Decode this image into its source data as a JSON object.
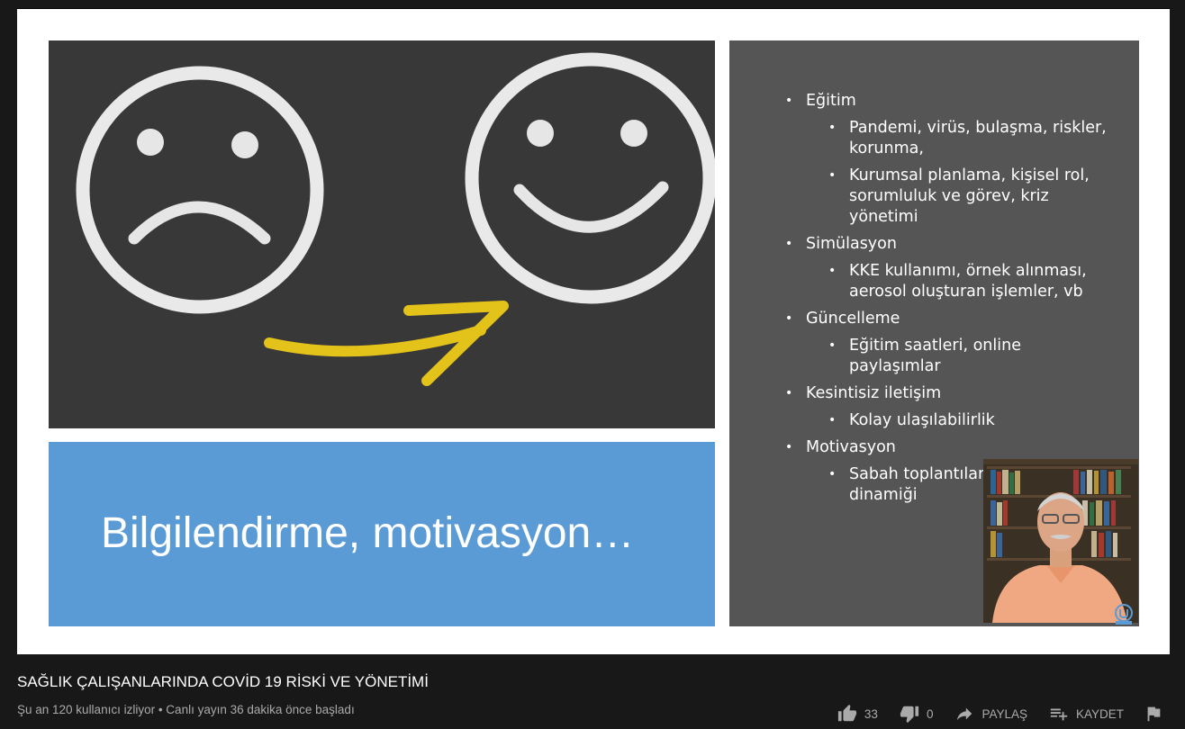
{
  "slide": {
    "caption": "Bilgilendirme, motivasyon…",
    "bullets": [
      {
        "text": "Eğitim",
        "subs": [
          "Pandemi, virüs, bulaşma, riskler, korunma,",
          "Kurumsal planlama, kişisel rol, sorumluluk ve görev, kriz yönetimi"
        ]
      },
      {
        "text": "Simülasyon",
        "subs": [
          "KKE kullanımı, örnek alınması, aerosol oluşturan işlemler, vb"
        ]
      },
      {
        "text": "Güncelleme",
        "subs": [
          "Eğitim saatleri, online paylaşımlar"
        ]
      },
      {
        "text": "Kesintisiz iletişim",
        "subs": [
          "Kolay ulaşılabilirlik"
        ]
      },
      {
        "text": "Motivasyon",
        "subs": [
          "Sabah toplantıları, dinleme, ekip dinamiği"
        ]
      }
    ]
  },
  "video": {
    "title": "SAĞLIK ÇALIŞANLARINDA COVİD 19 RİSKİ VE YÖNETİMİ",
    "meta": "Şu an 120 kullanıcı izliyor • Canlı yayın 36 dakika önce başladı",
    "likes": "33",
    "dislikes": "0",
    "share_label": "PAYLAŞ",
    "save_label": "KAYDET"
  },
  "colors": {
    "background": "#181818",
    "blue_box": "#5b9bd5",
    "right_panel": "#555555",
    "icon_gray": "#aaaaaa"
  }
}
